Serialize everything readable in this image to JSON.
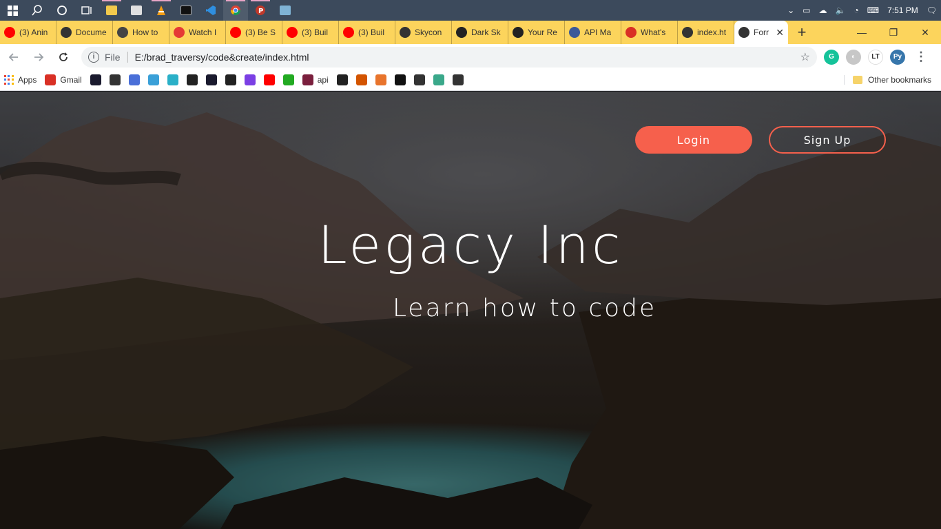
{
  "taskbar": {
    "clock": "7:51 PM",
    "apps": [
      {
        "icon": "windows-start-icon"
      },
      {
        "icon": "search-icon"
      },
      {
        "icon": "cortana-icon"
      },
      {
        "icon": "task-view-icon"
      },
      {
        "icon": "file-explorer-icon"
      },
      {
        "icon": "store-icon"
      },
      {
        "icon": "vlc-icon"
      },
      {
        "icon": "terminal-icon"
      },
      {
        "icon": "vscode-icon"
      },
      {
        "icon": "chrome-icon"
      },
      {
        "icon": "postman-icon"
      },
      {
        "icon": "photos-icon"
      }
    ]
  },
  "tabs": [
    {
      "title": "(3) Anin",
      "icon": "youtube-icon",
      "color": "#ff0000"
    },
    {
      "title": "Docume",
      "icon": "globe-icon",
      "color": "#333333"
    },
    {
      "title": "How to",
      "icon": "site-icon",
      "color": "#444444"
    },
    {
      "title": "Watch I",
      "icon": "shield-icon",
      "color": "#e53935"
    },
    {
      "title": "(3) Be S",
      "icon": "youtube-icon",
      "color": "#ff0000"
    },
    {
      "title": "(3) Buil",
      "icon": "youtube-icon",
      "color": "#ff0000"
    },
    {
      "title": "(3) Buil",
      "icon": "youtube-icon",
      "color": "#ff0000"
    },
    {
      "title": "Skycon",
      "icon": "globe-icon",
      "color": "#333333"
    },
    {
      "title": "Dark Sk",
      "icon": "darksky-icon",
      "color": "#222222"
    },
    {
      "title": "Your Re",
      "icon": "github-icon",
      "color": "#222222"
    },
    {
      "title": "API Ma",
      "icon": "api-icon",
      "color": "#3b5998"
    },
    {
      "title": "What's",
      "icon": "gmail-icon",
      "color": "#d93025"
    },
    {
      "title": "index.ht",
      "icon": "globe-icon",
      "color": "#333333"
    },
    {
      "title": "Forr",
      "icon": "globe-icon",
      "color": "#333333",
      "active": true
    }
  ],
  "window": {
    "minimize": "—",
    "restore": "❐",
    "close": "✕"
  },
  "address": {
    "scheme_label": "File",
    "url": "E:/brad_traversy/code&create/index.html"
  },
  "bookmarks": {
    "items": [
      {
        "label": "Apps",
        "icon": "apps-grid-icon"
      },
      {
        "label": "Gmail",
        "icon": "gmail-icon",
        "color": "#d93025"
      },
      {
        "label": "",
        "icon": "bookmark-1-icon",
        "color": "#1a1a2e"
      },
      {
        "label": "",
        "icon": "globe-icon",
        "color": "#333333"
      },
      {
        "label": "",
        "icon": "wifi-icon",
        "color": "#4a6fd8"
      },
      {
        "label": "",
        "icon": "bird-icon",
        "color": "#3aa0d8"
      },
      {
        "label": "",
        "icon": "shield-check-icon",
        "color": "#2ab0c8"
      },
      {
        "label": "",
        "icon": "target-icon",
        "color": "#222222"
      },
      {
        "label": "",
        "icon": "bookmark-2-icon",
        "color": "#1a1a2e"
      },
      {
        "label": "",
        "icon": "github-icon",
        "color": "#222222"
      },
      {
        "label": "",
        "icon": "brand-d-icon",
        "color": "#7b3fe4"
      },
      {
        "label": "",
        "icon": "youtube-icon",
        "color": "#ff0000"
      },
      {
        "label": "",
        "icon": "timer-icon",
        "color": "#22aa22"
      },
      {
        "label": "api",
        "icon": "iw-icon",
        "color": "#7a1f3d"
      },
      {
        "label": "",
        "icon": "horse-icon",
        "color": "#222222"
      },
      {
        "label": "",
        "icon": "badge-icon",
        "color": "#d35400"
      },
      {
        "label": "",
        "icon": "js-icon",
        "color": "#e8742c"
      },
      {
        "label": "",
        "icon": "medium-icon",
        "color": "#111111"
      },
      {
        "label": "",
        "icon": "globe-icon",
        "color": "#333333"
      },
      {
        "label": "",
        "icon": "d-icon",
        "color": "#3aa88a"
      },
      {
        "label": "",
        "icon": "globe-icon",
        "color": "#333333"
      }
    ],
    "other": "Other bookmarks"
  },
  "hero": {
    "login_label": "Login",
    "signup_label": "Sign Up",
    "title": "Legacy Inc",
    "subtitle": "Learn how to code",
    "accent": "#f6604c"
  }
}
